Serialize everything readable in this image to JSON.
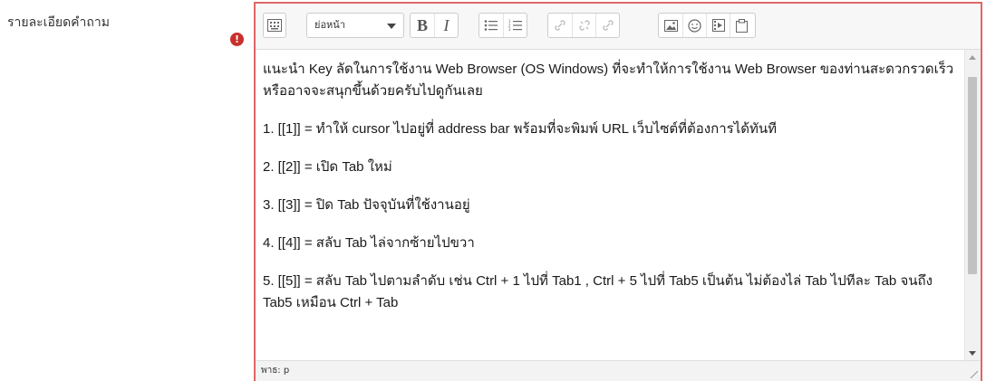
{
  "form": {
    "label": "รายละเอียดคำถาม",
    "required_symbol": "!"
  },
  "toolbar": {
    "toggle_icon": "keyboard-toggle-icon",
    "format_select": {
      "value": "ย่อหน้า"
    },
    "bold_label": "B",
    "italic_label": "I",
    "bullet_list_icon": "unordered-list-icon",
    "numbered_list_icon": "ordered-list-icon",
    "link_icon": "link-icon",
    "unlink_icon": "unlink-icon",
    "anchor_icon": "anchor-link-icon",
    "image_icon": "image-icon",
    "emoji_icon": "smiley-icon",
    "media_icon": "media-icon",
    "paste_icon": "paste-clipboard-icon"
  },
  "editor": {
    "paragraphs": [
      "แนะนำ Key ลัดในการใช้งาน Web Browser (OS Windows) ที่จะทำให้การใช้งาน Web Browser ของท่านสะดวกรวดเร็วหรืออาจจะสนุกขึ้นด้วยครับไปดูกันเลย",
      "1. [[1]] = ทำให้ cursor ไปอยู่ที่ address bar พร้อมที่จะพิมพ์ URL เว็บไซต์ที่ต้องการได้ทันที",
      "2. [[2]] = เปิด Tab ใหม่",
      "3. [[3]] = ปิด Tab ปัจจุบันที่ใช้งานอยู่",
      "4. [[4]] = สลับ Tab ไล่จากซ้ายไปขวา",
      "5. [[5]] = สลับ Tab ไปตามลำดับ เช่น  Ctrl + 1 ไปที่ Tab1 , Ctrl + 5 ไปที่ Tab5 เป็นต้น ไม่ต้องไล่ Tab ไปทีละ Tab จนถึง Tab5 เหมือน Ctrl + Tab"
    ]
  },
  "statusbar": {
    "path": "พาธ: p"
  },
  "colors": {
    "focus_border": "#e06666",
    "required_icon": "#c9302c"
  }
}
